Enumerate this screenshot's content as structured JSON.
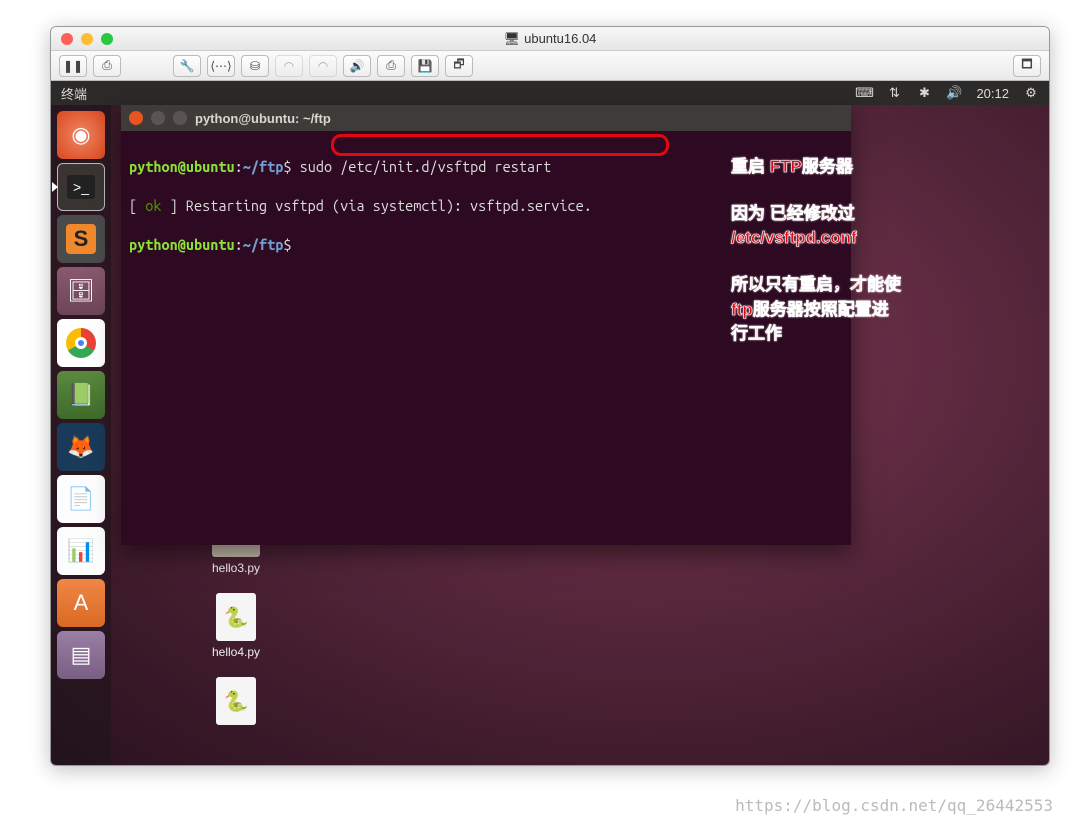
{
  "mac": {
    "title": "ubuntu16.04",
    "toolbar": [
      "pause",
      "snapshot",
      "settings",
      "network",
      "hdd",
      "cd1",
      "cd2",
      "sound",
      "usb",
      "floppy",
      "shared",
      "fullscreen"
    ]
  },
  "ubuntu": {
    "topbar_title": "终端",
    "time": "20:12"
  },
  "launcher": [
    {
      "name": "dash",
      "label": "◉"
    },
    {
      "name": "terminal",
      "label": ">_",
      "active": true
    },
    {
      "name": "sublime",
      "label": "S"
    },
    {
      "name": "files",
      "label": "🗄"
    },
    {
      "name": "chrome",
      "label": "◯"
    },
    {
      "name": "help",
      "label": "📗"
    },
    {
      "name": "firefox",
      "label": "🦊"
    },
    {
      "name": "writer",
      "label": "📄"
    },
    {
      "name": "calc",
      "label": "📊"
    },
    {
      "name": "software",
      "label": "A"
    },
    {
      "name": "trash",
      "label": "🗑"
    }
  ],
  "desktop_files": [
    {
      "name": "hello3.py",
      "type": "folder"
    },
    {
      "name": "hello4.py",
      "type": "py"
    },
    {
      "name": "",
      "type": "py"
    }
  ],
  "terminal": {
    "title": "python@ubuntu: ~/ftp",
    "user": "python",
    "host": "ubuntu",
    "path": "~/ftp",
    "dollar": "$",
    "command": "sudo /etc/init.d/vsftpd restart",
    "out_open": "[ ",
    "out_ok": "ok",
    "out_rest": " ] Restarting vsftpd (via systemctl): vsftpd.service."
  },
  "annotations": {
    "a1": "重启 FTP服务器",
    "a2": "因为 已经修改过 /etc/vsftpd.conf",
    "a3": "所以只有重启，才能使ftp服务器按照配置进行工作"
  },
  "watermark": "https://blog.csdn.net/qq_26442553"
}
